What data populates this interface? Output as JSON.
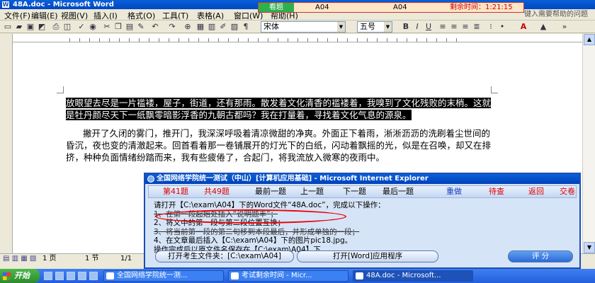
{
  "window": {
    "title": "48A.doc - Microsoft Word"
  },
  "menu": [
    "文件(F)",
    "编辑(E)",
    "视图(V)",
    "插入(I)",
    "格式(O)",
    "工具(T)",
    "表格(A)",
    "窗口(W)",
    "帮助(H)"
  ],
  "exam_timer": {
    "watch_label": "看题",
    "q_left": "A04",
    "q_right": "A04",
    "remain_label": "剩余时间：",
    "time": "1:21:15"
  },
  "help_prompt": "键入需要帮助的问题",
  "toolbar": {
    "font": "宋体",
    "size": "五号",
    "bold": "B",
    "italic": "I",
    "underline": "U"
  },
  "document": {
    "para1_selected": "放眼望去尽是一片褴褛，屋子，街道，还有那雨。散发着文化清香的褴褛着，我嗅到了文化残败的末梢。这就是牡丹颜尽天下一纸飘零暗影浮香的九朝古都吗？我在打量着，寻找着文化气息的源泉。",
    "para2": "撇开了久闭的雾门，推开门，我深深呼吸着清凉微甜的净爽。外面正下着雨，淅淅沥沥的洗刷着尘世间的昏沉，夜也变的清澈起来。回首看着那一卷铺展开的灯光下的白纸，闪动着飘摇的光，似是在召唤，却又在排挤，种种负面情绪纷踏而来，我有些疲倦了，合起门，将我流放入微寒的夜雨中。"
  },
  "status": {
    "page": "1 页",
    "section": "1 节",
    "pagecount": "1/1"
  },
  "exam": {
    "title": "全国网络学院统一测试（中山）[计算机应用基础] - Microsoft Internet Explorer",
    "current_label": "第41题",
    "total_label": "共49题",
    "nav": [
      "最前一题",
      "上一题",
      "下一题",
      "最后一题",
      "重做",
      "待查",
      "返回",
      "交卷"
    ],
    "instruction": "请打开【C:\\exam\\A04】下的Word文件“48A.doc”，完成以下操作：",
    "step1": "1、在第一段起始处插入“说明题丰”；",
    "step2": "2、将文中的第一段与第二段位置互换；",
    "step3": "3、将当前第一段的第二句移到本段最后，并形成单独的一段；",
    "step4": "4、在文章最后插入【C:\\exam\\A04】下的图片pic18.jpg。",
    "save_note": "操作完成后以原文件名保存在【C:\\exam\\A04】下。",
    "btn_open_folder": "打开考生文件夹：[C:\\exam\\A04]",
    "btn_open_word": "打开[Word]应用程序",
    "btn_score": "评 分"
  },
  "taskbar": {
    "start": "开始",
    "tasks": [
      "全国网络学院统一测...",
      "考试剩余时间 - Micr...",
      "48A.doc - Microsoft..."
    ]
  }
}
